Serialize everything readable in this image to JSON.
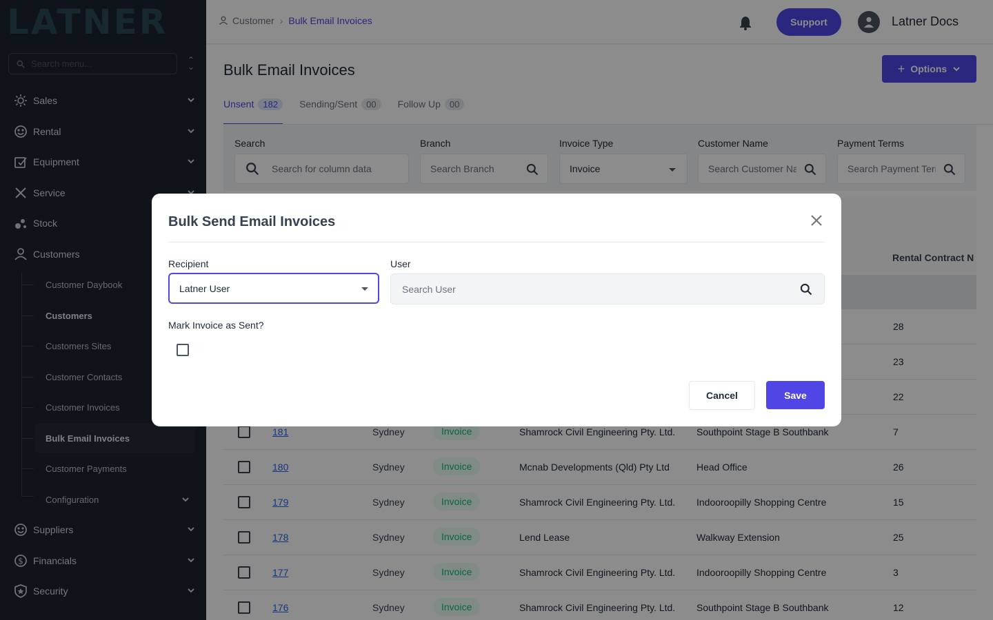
{
  "sidebar": {
    "logo": "LATNER",
    "search_placeholder": "Search menu...",
    "items": [
      {
        "label": "Sales",
        "icon": "sales-icon"
      },
      {
        "label": "Rental",
        "icon": "rental-icon"
      },
      {
        "label": "Equipment",
        "icon": "equipment-icon"
      },
      {
        "label": "Service",
        "icon": "service-icon"
      },
      {
        "label": "Stock",
        "icon": "stock-icon"
      },
      {
        "label": "Customers",
        "icon": "user-icon"
      }
    ],
    "sub_items": [
      {
        "label": "Customer Daybook"
      },
      {
        "label": "Customers"
      },
      {
        "label": "Customers Sites"
      },
      {
        "label": "Customer Contacts"
      },
      {
        "label": "Customer Invoices"
      },
      {
        "label": "Bulk Email Invoices"
      },
      {
        "label": "Customer Payments"
      },
      {
        "label": "Configuration"
      }
    ],
    "bottom_items": [
      {
        "label": "Suppliers",
        "icon": "suppliers-icon"
      },
      {
        "label": "Financials",
        "icon": "financials-icon"
      },
      {
        "label": "Security",
        "icon": "shield-icon"
      }
    ]
  },
  "header": {
    "breadcrumb": {
      "parent": "Customer",
      "current": "Bulk Email Invoices"
    },
    "support_label": "Support",
    "user_name": "Latner Docs"
  },
  "page": {
    "title": "Bulk Email Invoices",
    "options_label": "Options",
    "tabs": [
      {
        "label": "Unsent",
        "count": "182"
      },
      {
        "label": "Sending/Sent",
        "count": "00"
      },
      {
        "label": "Follow Up",
        "count": "00"
      }
    ],
    "filters": {
      "search": {
        "label": "Search",
        "placeholder": "Search for column data"
      },
      "branch": {
        "label": "Branch",
        "placeholder": "Search Branch"
      },
      "invoice_type": {
        "label": "Invoice Type",
        "value": "Invoice"
      },
      "customer_name": {
        "label": "Customer Name",
        "placeholder": "Search Customer Name"
      },
      "payment_terms": {
        "label": "Payment Terms",
        "placeholder": "Search Payment Terms"
      }
    },
    "table": {
      "visible_header": "Rental Contract N",
      "rows": [
        {
          "number": "",
          "branch": "",
          "type": "",
          "customer": "",
          "site": "",
          "rc": "28"
        },
        {
          "number": "",
          "branch": "",
          "type": "",
          "customer": "",
          "site": "",
          "rc": "23"
        },
        {
          "number": "",
          "branch": "",
          "type": "",
          "customer": "",
          "site": "",
          "rc": "22"
        },
        {
          "number": "181",
          "branch": "Sydney",
          "type": "Invoice",
          "customer": "Shamrock Civil Engineering Pty. Ltd.",
          "site": "Southpoint Stage B Southbank",
          "rc": "7"
        },
        {
          "number": "180",
          "branch": "Sydney",
          "type": "Invoice",
          "customer": "Mcnab Developments (Qld) Pty Ltd",
          "site": "Head Office",
          "rc": "26"
        },
        {
          "number": "179",
          "branch": "Sydney",
          "type": "Invoice",
          "customer": "Shamrock Civil Engineering Pty. Ltd.",
          "site": "Indooroopilly Shopping Centre",
          "rc": "15"
        },
        {
          "number": "178",
          "branch": "Sydney",
          "type": "Invoice",
          "customer": "Lend Lease",
          "site": "Walkway Extension",
          "rc": "25"
        },
        {
          "number": "177",
          "branch": "Sydney",
          "type": "Invoice",
          "customer": "Shamrock Civil Engineering Pty. Ltd.",
          "site": "Indooroopilly Shopping Centre",
          "rc": "3"
        },
        {
          "number": "176",
          "branch": "Sydney",
          "type": "Invoice",
          "customer": "Shamrock Civil Engineering Pty. Ltd.",
          "site": "Southpoint Stage B Southbank",
          "rc": "12"
        }
      ]
    }
  },
  "modal": {
    "title": "Bulk Send Email Invoices",
    "recipient_label": "Recipient",
    "recipient_value": "Latner User",
    "user_label": "User",
    "user_placeholder": "Search User",
    "mark_sent_label": "Mark Invoice as Sent?",
    "cancel_label": "Cancel",
    "save_label": "Save"
  },
  "colors": {
    "accent": "#4f46e5",
    "sidebar": "#1d2430",
    "badge_text": "#10b981"
  }
}
